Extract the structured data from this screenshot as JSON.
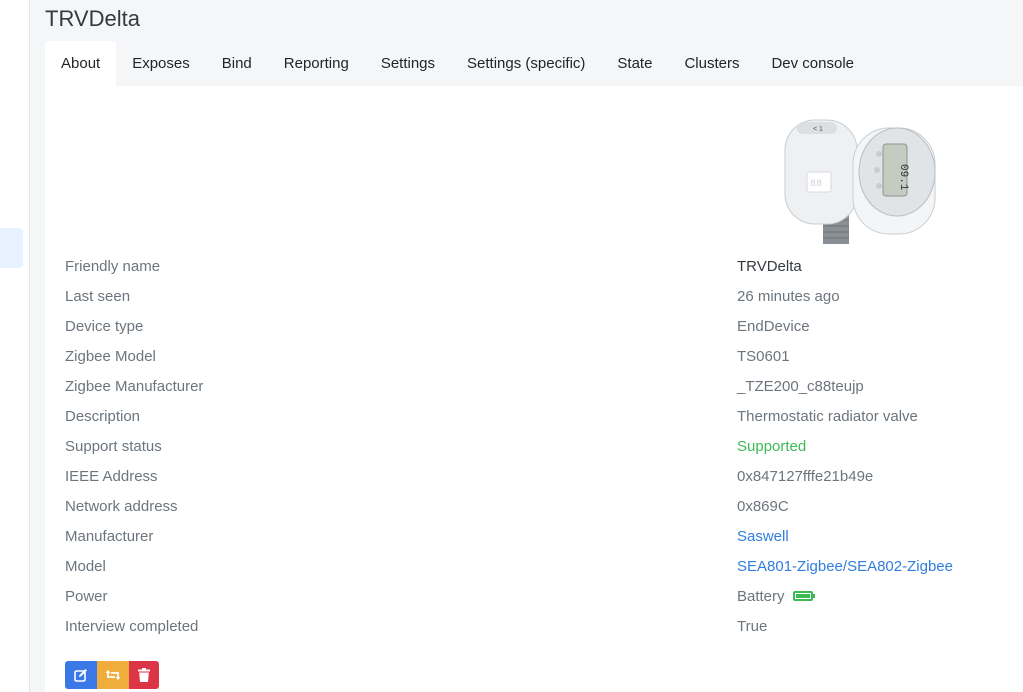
{
  "header": {
    "title": "TRVDelta"
  },
  "tabs": [
    {
      "label": "About"
    },
    {
      "label": "Exposes"
    },
    {
      "label": "Bind"
    },
    {
      "label": "Reporting"
    },
    {
      "label": "Settings"
    },
    {
      "label": "Settings (specific)"
    },
    {
      "label": "State"
    },
    {
      "label": "Clusters"
    },
    {
      "label": "Dev console"
    }
  ],
  "active_tab": "About",
  "device_image": {
    "display_digits": "09.1"
  },
  "info": [
    {
      "label": "Friendly name",
      "value": "TRVDelta"
    },
    {
      "label": "Last seen",
      "value": "26 minutes ago"
    },
    {
      "label": "Device type",
      "value": "EndDevice"
    },
    {
      "label": "Zigbee Model",
      "value": "TS0601"
    },
    {
      "label": "Zigbee Manufacturer",
      "value": "_TZE200_c88teujp"
    },
    {
      "label": "Description",
      "value": "Thermostatic radiator valve"
    },
    {
      "label": "Support status",
      "value": "Supported"
    },
    {
      "label": "IEEE Address",
      "value": "0x847127fffe21b49e"
    },
    {
      "label": "Network address",
      "value": "0x869C"
    },
    {
      "label": "Manufacturer",
      "value": "Saswell"
    },
    {
      "label": "Model",
      "value": "SEA801-Zigbee/SEA802-Zigbee"
    },
    {
      "label": "Power",
      "value": "Battery"
    },
    {
      "label": "Interview completed",
      "value": "True"
    }
  ],
  "colors": {
    "primary": "#3b78e7",
    "warning": "#f0ad3c",
    "danger": "#dc3545",
    "success": "#3cba54",
    "link": "#2f7de1"
  },
  "icons": {
    "edit": "pencil-square-icon",
    "reconfigure": "retweet-icon",
    "remove": "trash-icon",
    "power": "battery-full-icon"
  }
}
